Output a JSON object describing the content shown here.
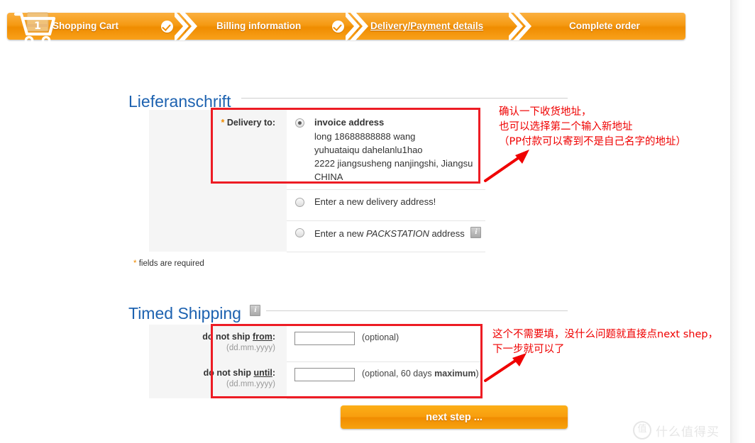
{
  "steps": [
    {
      "label": "Shopping Cart",
      "state": "done",
      "badge": "check-icon"
    },
    {
      "label": "Billing information",
      "state": "done",
      "badge": "check-icon"
    },
    {
      "label": "Delivery/Payment details",
      "state": "current",
      "badge": ""
    },
    {
      "label": "Complete order",
      "state": "todo",
      "badge": ""
    }
  ],
  "cart": {
    "badge_count": "1"
  },
  "delivery": {
    "heading": "Lieferanschrift",
    "field_label": "Delivery to:",
    "required_marker": "*",
    "options": [
      {
        "label": "invoice address",
        "selected": true
      },
      {
        "label": "Enter a new delivery address!",
        "selected": false
      },
      {
        "label_pre": "Enter a new ",
        "label_em": "PACKSTATION",
        "label_post": " address",
        "selected": false,
        "info": "info-icon"
      }
    ],
    "address_lines": [
      "long 18688888888 wang",
      "yuhuataiqu dahelanlu1hao",
      "2222 jiangsusheng nanjingshi, Jiangsu",
      "CHINA"
    ],
    "required_note_star": "*",
    "required_note": "fields are required"
  },
  "timed": {
    "heading": "Timed Shipping",
    "info": "info-icon",
    "rows": [
      {
        "label": "do not ship ",
        "label_u": "from",
        "colon": ":",
        "format": "(dd.mm.yyyy)",
        "value": "",
        "hint_pre": "(optional)",
        "hint_b": "",
        "hint_post": ""
      },
      {
        "label": "do not ship ",
        "label_u": "until",
        "colon": ":",
        "format": "(dd.mm.yyyy)",
        "value": "",
        "hint_pre": "(optional, 60 days ",
        "hint_b": "maximum",
        "hint_post": ")"
      }
    ]
  },
  "next_button": "next step ...",
  "annotations": [
    {
      "lines": [
        "确认一下收货地址，",
        "也可以选择第二个输入新地址",
        "（PP付款可以寄到不是自己名字的地址）"
      ]
    },
    {
      "lines": [
        "这个不需要填，没什么问题就直接点next shep，",
        "下一步就可以了"
      ]
    }
  ],
  "watermark": {
    "logo": "值",
    "text": "什么值得买"
  },
  "colors": {
    "accent_orange": "#f08c00",
    "heading_blue": "#1d62b0",
    "annotation_red": "#ef0000",
    "box_red": "#ed1c24",
    "label_gray": "#f5f5f5"
  }
}
